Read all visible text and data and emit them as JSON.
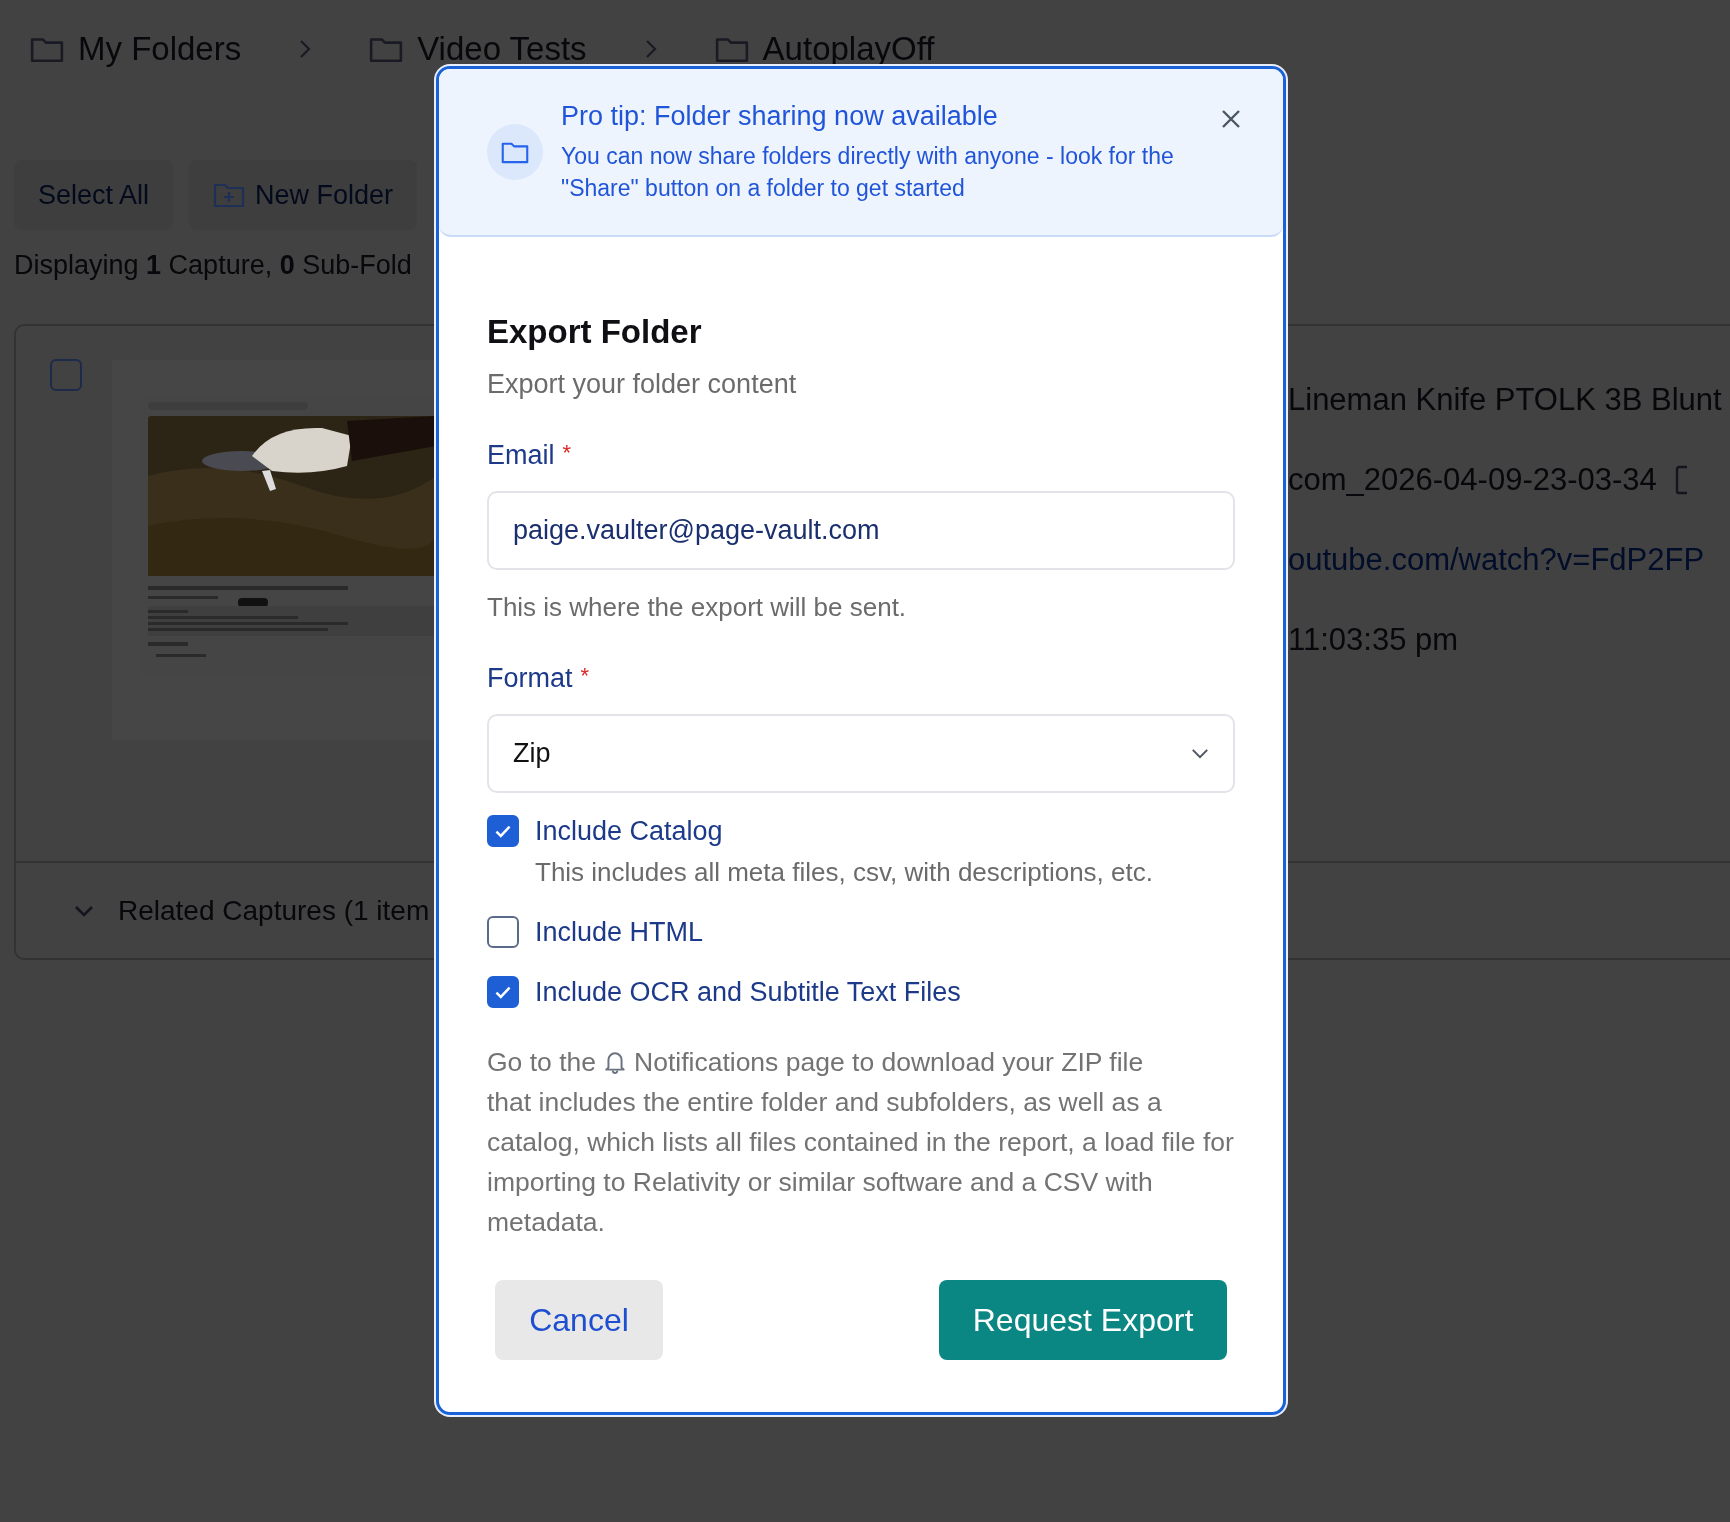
{
  "breadcrumb": [
    {
      "label": "My Folders"
    },
    {
      "label": "Video Tests"
    },
    {
      "label": "AutoplayOff"
    }
  ],
  "toolbar": [
    {
      "kind": "plain",
      "label": "Select All"
    },
    {
      "kind": "new-folder",
      "label": "New Folder"
    }
  ],
  "summary": "Displaying **1** Capture, **0** Sub-Fold",
  "capture": {
    "checked": false,
    "details": [
      {
        "kind": "text",
        "value": "Lineman Knife PTOLK 3B Blunt"
      },
      {
        "kind": "file",
        "value": "com_2026-04-09-23-03-34"
      },
      {
        "kind": "link",
        "value": "outube.com/watch?v=FdP2FP"
      },
      {
        "kind": "text",
        "value": "11:03:35 pm"
      }
    ],
    "related": "Related Captures (1 item"
  },
  "modal": {
    "tip": {
      "title": "Pro tip: Folder sharing now available",
      "body": "You can now share folders directly with anyone - look for the \"Share\" button on a folder to get started"
    },
    "title": "Export Folder",
    "subtitle": "Export your folder content",
    "fields": [
      {
        "kind": "input",
        "label": "Email",
        "required_mark": "*",
        "value": "paige.vaulter@page-vault.com",
        "help": "This is where the export will be sent."
      },
      {
        "kind": "select",
        "label": "Format",
        "required_mark": "*",
        "value": "Zip"
      }
    ],
    "options": [
      {
        "label": "Include Catalog",
        "checked": true,
        "description": "This includes all meta files, csv, with descriptions, etc."
      },
      {
        "label": "Include HTML",
        "checked": false
      },
      {
        "label": "Include OCR and Subtitle Text Files",
        "checked": true
      }
    ],
    "note_before": "Go to the",
    "note_line": "Notifications page to download your ZIP file",
    "note_rest": "that includes the entire folder and subfolders, as well as a catalog, which lists all files contained in the report, a load file for importing to Relativity or similar software and a CSV with metadata.",
    "buttons": [
      {
        "kind": "secondary",
        "label": "Cancel"
      },
      {
        "kind": "primary",
        "label": "Request Export"
      }
    ]
  }
}
